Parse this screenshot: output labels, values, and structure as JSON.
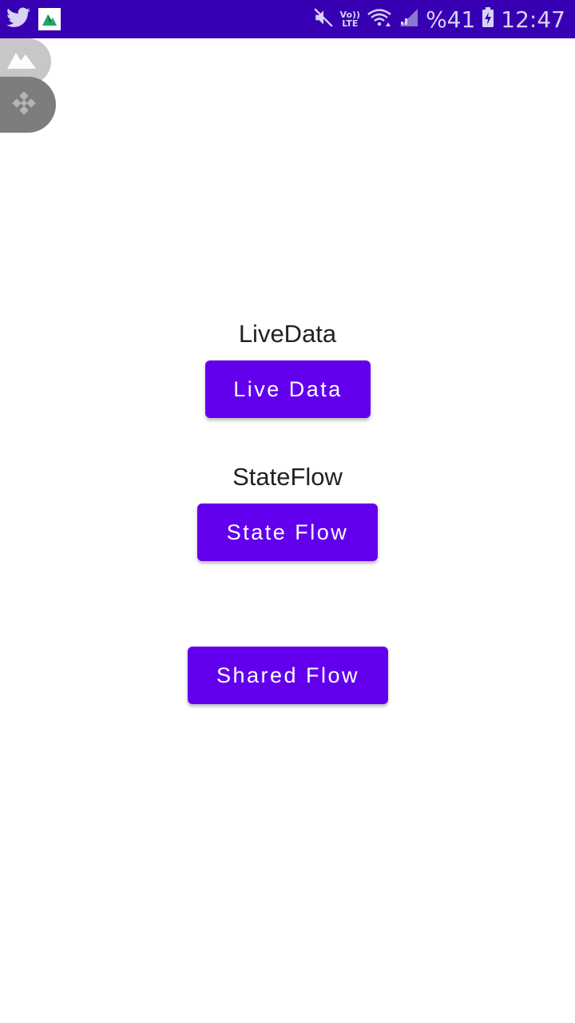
{
  "status_bar": {
    "left_icons": [
      "twitter-icon",
      "app-notification-icon"
    ],
    "right_icons": [
      "mute-icon",
      "volte-icon",
      "wifi-icon",
      "signal-icon",
      "battery-charging-icon"
    ],
    "volte_top": "Vo))",
    "volte_bottom": "LTE",
    "battery_percent": "%41",
    "time": "12:47"
  },
  "overlay": {
    "bubbles": [
      "mountain-app-icon",
      "diamond-app-icon"
    ]
  },
  "main": {
    "livedata_label": "LiveData",
    "livedata_button": "Live Data",
    "stateflow_label": "StateFlow",
    "stateflow_button": "State Flow",
    "sharedflow_button": "Shared Flow"
  },
  "colors": {
    "status_bar": "#3700B3",
    "button": "#6200EE",
    "background": "#FFFFFF"
  }
}
